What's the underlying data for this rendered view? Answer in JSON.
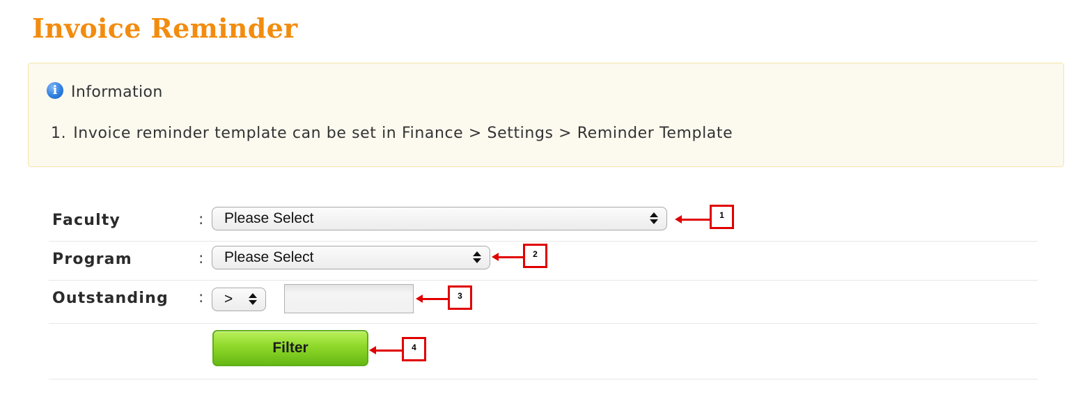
{
  "page": {
    "title": "Invoice Reminder"
  },
  "info": {
    "icon": "info-icon",
    "icon_glyph": "i",
    "heading": "Information",
    "items": [
      {
        "number": "1.",
        "text": "Invoice reminder template can be set in Finance > Settings > Reminder Template"
      }
    ]
  },
  "form": {
    "faculty": {
      "label": "Faculty",
      "colon": ":",
      "selected": "Please Select"
    },
    "program": {
      "label": "Program",
      "colon": ":",
      "selected": "Please Select"
    },
    "outstanding": {
      "label": "Outstanding",
      "colon": ":",
      "operator": ">",
      "amount": ""
    },
    "filter_label": "Filter"
  },
  "callouts": [
    "1",
    "2",
    "3",
    "4"
  ],
  "colors": {
    "title": "#f28c0f",
    "callout": "#e00000",
    "button": "#8fd82a"
  }
}
